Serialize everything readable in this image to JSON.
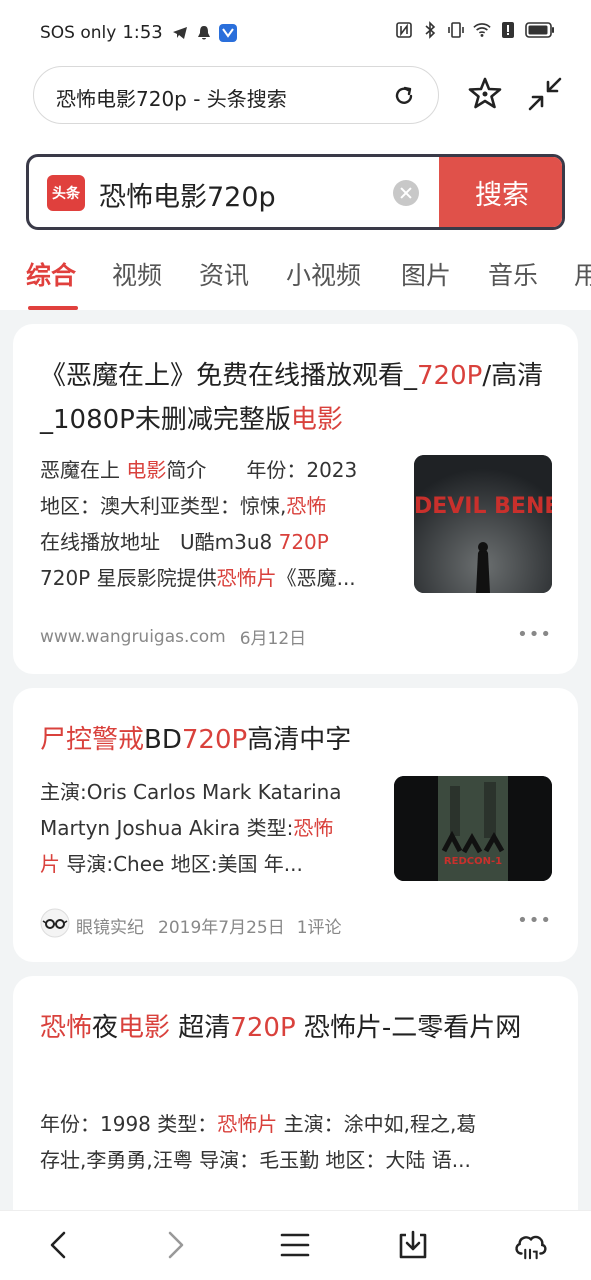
{
  "status_bar": {
    "carrier": "SOS only",
    "time": "1:53"
  },
  "browser": {
    "url_title": "恐怖电影720p - 头条搜索",
    "icons": [
      "reload-icon",
      "star-icon",
      "collapse-icon"
    ]
  },
  "search": {
    "logo_text": "头条",
    "query": "恐怖电影720p",
    "button_label": "搜索"
  },
  "tabs": [
    {
      "label": "综合",
      "active": true
    },
    {
      "label": "视频"
    },
    {
      "label": "资讯"
    },
    {
      "label": "小视频"
    },
    {
      "label": "图片"
    },
    {
      "label": "音乐"
    },
    {
      "label": "用"
    }
  ],
  "results": [
    {
      "title_parts": [
        {
          "text": "《恶魔在上》免费在线播放观看_",
          "hl": false
        },
        {
          "text": "720P",
          "hl": true
        },
        {
          "text": "/高清_1080P未删减完整版",
          "hl": false
        },
        {
          "text": "电影",
          "hl": true
        }
      ],
      "snippet_lines": [
        [
          {
            "text": "恶魔在上 ",
            "hl": false
          },
          {
            "text": "电影",
            "hl": true
          },
          {
            "text": "简介　　年份：2023",
            "hl": false
          }
        ],
        [
          {
            "text": "地区：澳大利亚类型：惊悚,",
            "hl": false
          },
          {
            "text": "恐怖",
            "hl": true
          }
        ],
        [
          {
            "text": "在线播放地址　U酷m3u8 ",
            "hl": false
          },
          {
            "text": "720P",
            "hl": true
          }
        ],
        [
          {
            "text": "720P 星辰影院提供",
            "hl": false
          },
          {
            "text": "恐怖片",
            "hl": true
          },
          {
            "text": "《恶魔...",
            "hl": false
          }
        ]
      ],
      "thumb_title": "THE DEVIL BENEATH",
      "source": "www.wangruigas.com",
      "date": "6月12日",
      "more": "•••"
    },
    {
      "title_parts": [
        {
          "text": "尸控警戒",
          "hl": true
        },
        {
          "text": "BD",
          "hl": false
        },
        {
          "text": "720P",
          "hl": true
        },
        {
          "text": "高清中字",
          "hl": false
        }
      ],
      "snippet_lines": [
        [
          {
            "text": "主演:Oris Carlos Mark Katarina",
            "hl": false
          }
        ],
        [
          {
            "text": "Martyn Joshua Akira 类型:",
            "hl": false
          },
          {
            "text": "恐怖",
            "hl": true
          }
        ],
        [
          {
            "text": "片",
            "hl": true
          },
          {
            "text": " 导演:Chee 地区:美国 年...",
            "hl": false
          }
        ]
      ],
      "thumb_title": "REDCON-1",
      "source": "眼镜实纪",
      "date": "2019年7月25日",
      "comments": "1评论",
      "more": "•••"
    },
    {
      "title_parts": [
        {
          "text": "恐怖",
          "hl": true
        },
        {
          "text": "夜",
          "hl": false
        },
        {
          "text": "电影",
          "hl": true
        },
        {
          "text": " 超清",
          "hl": false
        },
        {
          "text": "720P",
          "hl": true
        },
        {
          "text": " 恐怖片-二零看片网",
          "hl": false
        }
      ],
      "snippet_lines": [
        [
          {
            "text": "年份：1998 类型：",
            "hl": false
          },
          {
            "text": "恐怖片",
            "hl": true
          },
          {
            "text": " 主演：涂中如,程之,葛",
            "hl": false
          }
        ],
        [
          {
            "text": "存壮,李勇勇,汪粤 导演：毛玉勤 地区：大陆 语...",
            "hl": false
          }
        ]
      ]
    }
  ],
  "bottom_nav": [
    "back-icon",
    "forward-icon",
    "menu-icon",
    "download-icon",
    "cloud-icon"
  ],
  "colors": {
    "accent": "#e0403d",
    "search_button": "#e0514a",
    "feed_bg": "#f2f4f5"
  }
}
